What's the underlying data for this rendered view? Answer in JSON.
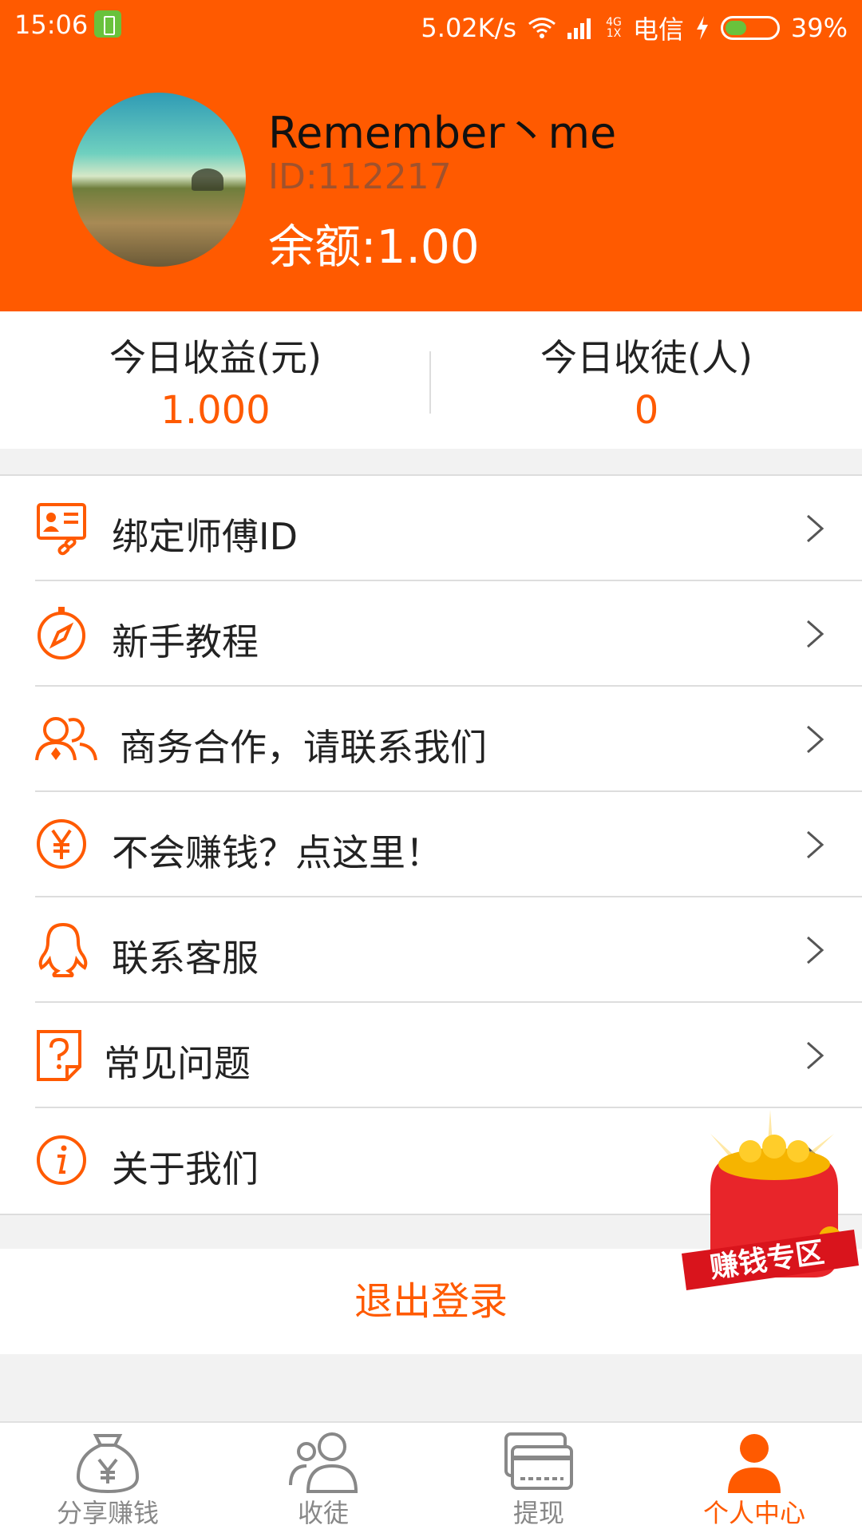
{
  "status_bar": {
    "time": "15:06",
    "network_speed": "5.02K/s",
    "network_type_top": "4G",
    "network_type_bottom": "1X",
    "carrier": "电信",
    "battery_percent": "39%",
    "battery_level": 0.39
  },
  "profile": {
    "name": "Remember丶me",
    "id_text": "ID:112217",
    "balance_text": "余额:1.00"
  },
  "stats": {
    "today_income_label": "今日收益(元)",
    "today_income_value": "1.000",
    "today_disciples_label": "今日收徒(人)",
    "today_disciples_value": "0"
  },
  "menu": {
    "items": [
      {
        "label": "绑定师傅ID",
        "icon": "id-card-link-icon"
      },
      {
        "label": "新手教程",
        "icon": "compass-icon"
      },
      {
        "label": "商务合作，请联系我们",
        "icon": "users-icon"
      },
      {
        "label": "不会赚钱？点这里！",
        "icon": "yen-circle-icon"
      },
      {
        "label": "联系客服",
        "icon": "qq-icon"
      },
      {
        "label": "常见问题",
        "icon": "question-doc-icon"
      },
      {
        "label": "关于我们",
        "icon": "info-circle-icon"
      }
    ]
  },
  "floating_badge_text": "赚钱专区",
  "logout_label": "退出登录",
  "tabbar": {
    "tabs": [
      {
        "label": "分享赚钱",
        "icon": "money-bag-icon",
        "active": false
      },
      {
        "label": "收徒",
        "icon": "people-icon",
        "active": false
      },
      {
        "label": "提现",
        "icon": "card-icon",
        "active": false
      },
      {
        "label": "个人中心",
        "icon": "person-icon",
        "active": true
      }
    ]
  },
  "colors": {
    "accent": "#ff5a00",
    "header_bg": "#ff5a00",
    "text_dark": "#222222",
    "tab_inactive": "#888888"
  }
}
